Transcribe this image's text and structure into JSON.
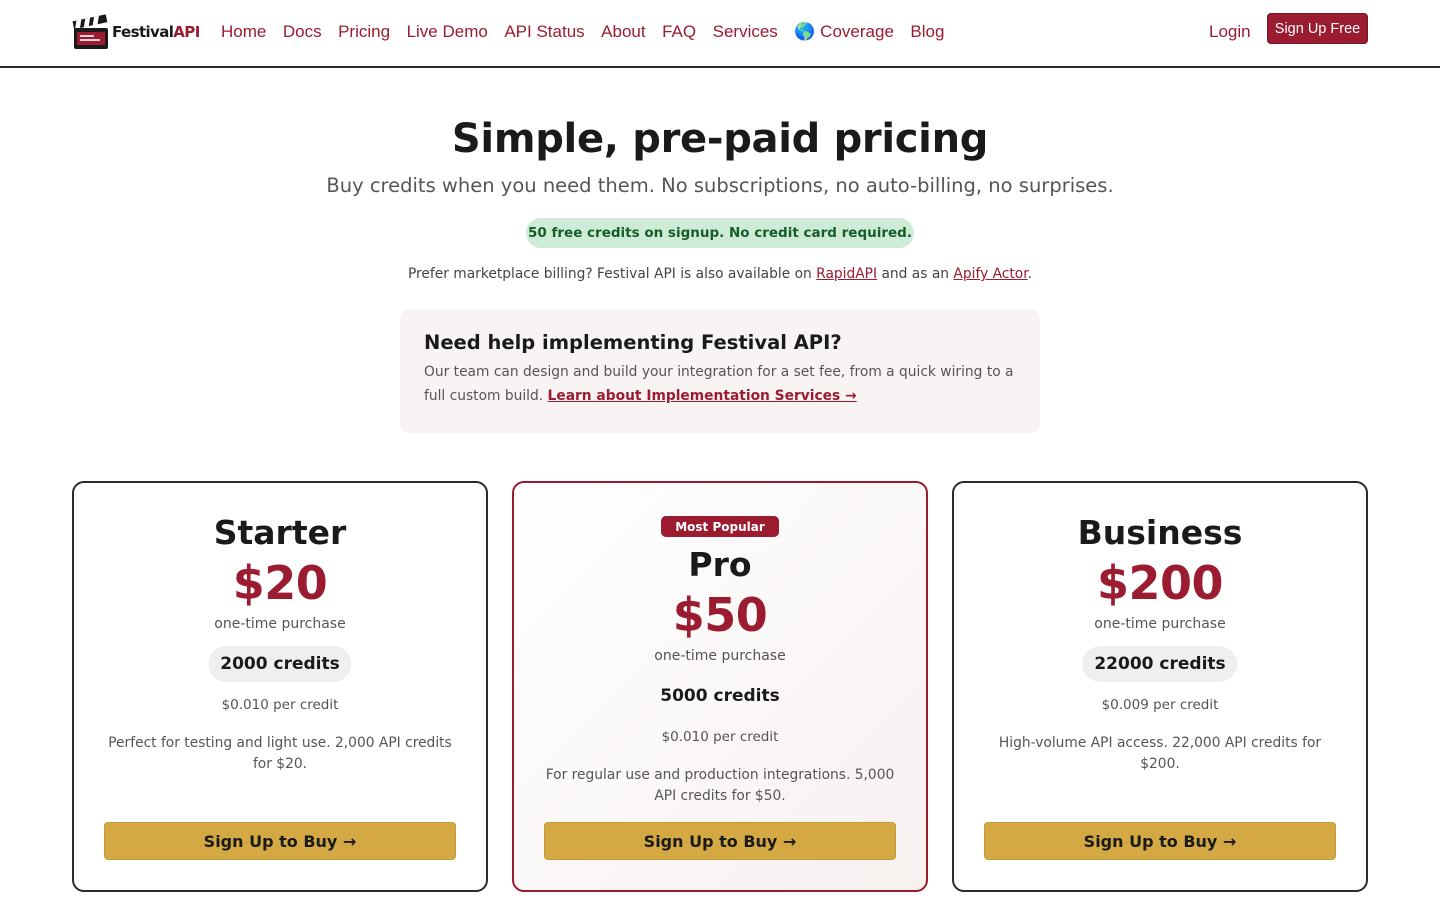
{
  "header": {
    "logo": {
      "text_main": "Festival",
      "text_accent": "API",
      "icon": "clapperboard-icon"
    },
    "nav": [
      {
        "label": "Home"
      },
      {
        "label": "Docs"
      },
      {
        "label": "Pricing"
      },
      {
        "label": "Live Demo"
      },
      {
        "label": "API Status"
      },
      {
        "label": "About"
      },
      {
        "label": "FAQ"
      },
      {
        "label": "Services"
      },
      {
        "label": "🌎 Coverage"
      },
      {
        "label": "Blog"
      }
    ],
    "login_label": "Login",
    "signup_label": "Sign Up Free"
  },
  "hero": {
    "title": "Simple, pre-paid pricing",
    "subtitle": "Buy credits when you need them. No subscriptions, no auto-billing, no surprises.",
    "free_badge": "50 free credits on signup. No credit card required."
  },
  "marketplace": {
    "prefix": "Prefer marketplace billing? Festival API is also available on ",
    "rapidapi_link": "RapidAPI",
    "middle": " and as an ",
    "apify_link": "Apify Actor",
    "suffix": "."
  },
  "help_box": {
    "title": "Need help implementing Festival API?",
    "body": "Our team can design and build your integration for a set fee, from a quick wiring to a full custom build. ",
    "link": "Learn about Implementation Services →"
  },
  "plans": [
    {
      "name": "Starter",
      "price": "$20",
      "purchase_type": "one-time purchase",
      "credits": "2000 credits",
      "per_credit": "$0.010 per credit",
      "description": "Perfect for testing and light use. 2,000 API credits for $20.",
      "button": "Sign Up to Buy →"
    },
    {
      "name": "Pro",
      "badge": "Most Popular",
      "price": "$50",
      "purchase_type": "one-time purchase",
      "credits": "5000 credits",
      "per_credit": "$0.010 per credit",
      "description": "For regular use and production integrations. 5,000 API credits for $50.",
      "button": "Sign Up to Buy →"
    },
    {
      "name": "Business",
      "price": "$200",
      "purchase_type": "one-time purchase",
      "credits": "22000 credits",
      "per_credit": "$0.009 per credit",
      "description": "High-volume API access. 22,000 API credits for $200.",
      "button": "Sign Up to Buy →"
    }
  ],
  "colors": {
    "brand": "#9b1b30",
    "button_gold": "#d4a843",
    "badge_green_bg": "#cdebd6",
    "badge_green_text": "#155d2a"
  }
}
